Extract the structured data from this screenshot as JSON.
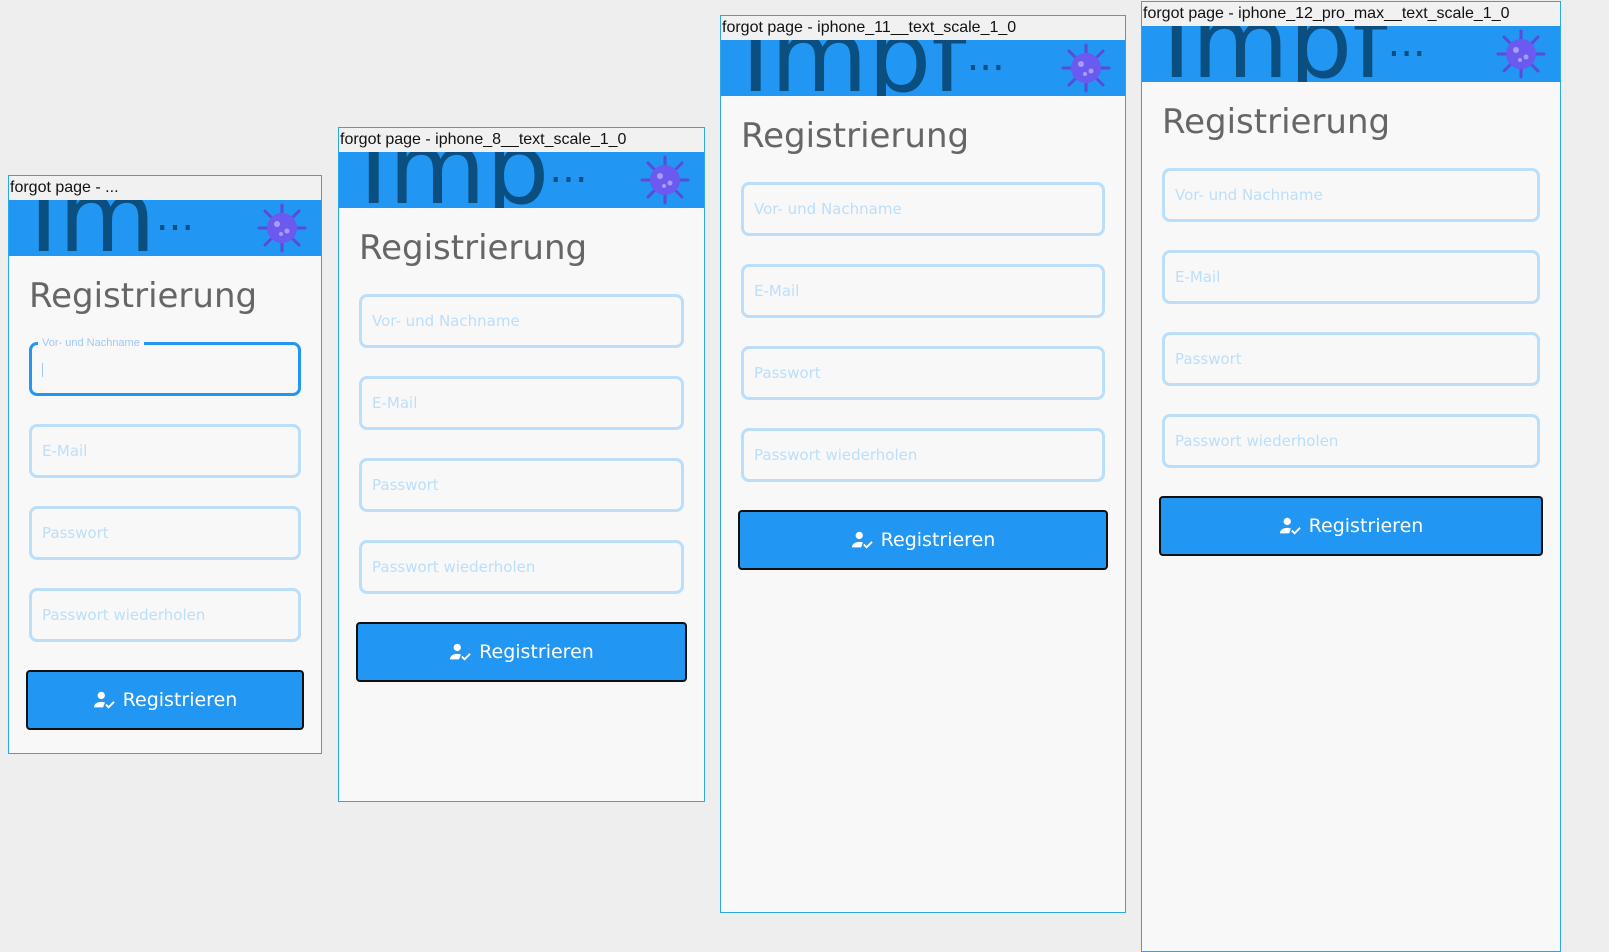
{
  "frames": [
    {
      "title": "forgot page - ...",
      "app_title": "Im",
      "app_dots": "...",
      "heading": "Registrierung",
      "fields": [
        "Vor- und Nachname",
        "E-Mail",
        "Passwort",
        "Passwort wiederholen"
      ],
      "focused_label": "Vor- und Nachname",
      "button": "Registrieren"
    },
    {
      "title": "forgot page - iphone_8__text_scale_1_0",
      "app_title": "Imp",
      "app_dots": "...",
      "heading": "Registrierung",
      "fields": [
        "Vor- und Nachname",
        "E-Mail",
        "Passwort",
        "Passwort wiederholen"
      ],
      "button": "Registrieren"
    },
    {
      "title": "forgot page - iphone_11__text_scale_1_0",
      "app_title": "Impf",
      "app_dots": "...",
      "heading": "Registrierung",
      "fields": [
        "Vor- und Nachname",
        "E-Mail",
        "Passwort",
        "Passwort wiederholen"
      ],
      "button": "Registrieren"
    },
    {
      "title": "forgot page - iphone_12_pro_max__text_scale_1_0",
      "app_title": "Impf",
      "app_dots": "...",
      "heading": "Registrierung",
      "fields": [
        "Vor- und Nachname",
        "E-Mail",
        "Passwort",
        "Passwort wiederholen"
      ],
      "button": "Registrieren"
    }
  ],
  "colors": {
    "accent": "#2196f3",
    "app_title": "#0a4f80",
    "frame_border": "#2aa7e6",
    "field_border": "#bbdefb"
  },
  "icons": {
    "app_logo": "virus-icon",
    "button": "person-check-icon"
  }
}
